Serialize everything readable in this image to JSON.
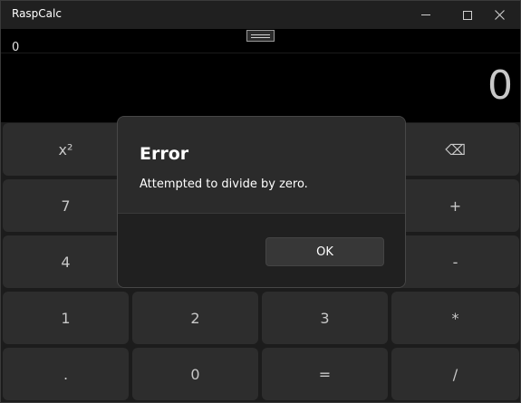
{
  "window": {
    "title": "RaspCalc",
    "controls": {
      "minimize": "–",
      "maximize": "□",
      "close": "✕"
    }
  },
  "display": {
    "expression": "0",
    "result": "0"
  },
  "keypad": {
    "square": "x²",
    "backspace": "⌫",
    "seven": "7",
    "plus": "+",
    "four": "4",
    "minus": "-",
    "one": "1",
    "two": "2",
    "three": "3",
    "multiply": "*",
    "decimal": ".",
    "zero": "0",
    "equals": "=",
    "divide": "/"
  },
  "dialog": {
    "title": "Error",
    "message": "Attempted to divide by zero.",
    "ok_label": "OK"
  },
  "colors": {
    "background": "#1c1c1c",
    "display": "#000000",
    "key": "#2d2d2d",
    "dialog": "#2b2b2b"
  }
}
